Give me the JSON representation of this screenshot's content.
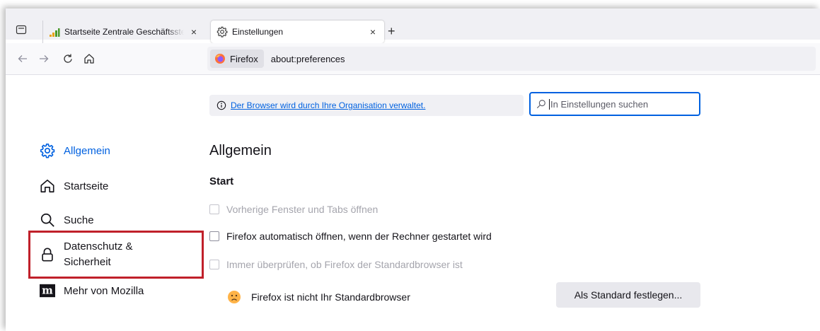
{
  "tabs": [
    {
      "title": "Startseite Zentrale Geschäftsstel",
      "close": "×"
    },
    {
      "title": "Einstellungen",
      "close": "×"
    }
  ],
  "newtab_label": "+",
  "urlbar": {
    "identity": "Firefox",
    "url": "about:preferences"
  },
  "managed_notice": "Der Browser wird durch Ihre Organisation verwaltet.",
  "search": {
    "placeholder": "In Einstellungen suchen"
  },
  "sidebar": {
    "items": [
      {
        "label": "Allgemein",
        "icon": "gear-icon",
        "active": true
      },
      {
        "label": "Startseite",
        "icon": "home-icon"
      },
      {
        "label": "Suche",
        "icon": "search-icon"
      },
      {
        "label": "Datenschutz & Sicherheit",
        "label_line1": "Datenschutz &",
        "label_line2": "Sicherheit",
        "icon": "lock-icon"
      },
      {
        "label": "Mehr von Mozilla",
        "icon": "mozilla-icon"
      }
    ]
  },
  "main": {
    "heading": "Allgemein",
    "section": "Start",
    "checkboxes": [
      {
        "label": "Vorherige Fenster und Tabs öffnen",
        "checked": false,
        "disabled": true
      },
      {
        "label": "Firefox automatisch öffnen, wenn der Rechner gestartet wird",
        "checked": false,
        "disabled": false
      },
      {
        "label": "Immer überprüfen, ob Firefox der Standardbrowser ist",
        "checked": false,
        "disabled": true
      }
    ],
    "default_status": "Firefox ist nicht Ihr Standardbrowser",
    "default_button": "Als Standard festlegen..."
  },
  "colors": {
    "accent": "#0061e0",
    "highlight": "#c0202a"
  }
}
